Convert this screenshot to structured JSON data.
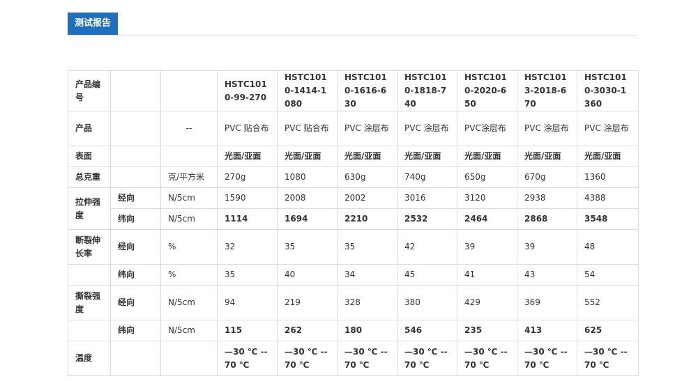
{
  "header": {
    "tab_label": "测试报告"
  },
  "colors": {
    "tab_background": "#1f6fbd",
    "tab_text": "#ffffff",
    "border": "#dcdcdc"
  },
  "table": {
    "product_code": {
      "label": "产品编号",
      "values": [
        "HSTC1010-99-270",
        "HSTC1010-1414-1080",
        "HSTC1010-1616-630",
        "HSTC1010-1818-740",
        "HSTC1010-2020-650",
        "HSTC1013-2018-670",
        "HSTC1010-3030-1360"
      ]
    },
    "product": {
      "label": "产品",
      "unit": "--",
      "values": [
        "PVC 贴合布",
        "PVC 贴合布",
        "PVC 涂层布",
        "PVC 涂层布",
        "PVC涂层布",
        "PVC 涂层布",
        "PVC 涂层布"
      ]
    },
    "surface": {
      "label": "表面",
      "values": [
        "光面/亚面",
        "光面/亚面",
        "光面/亚面",
        "光面/亚面",
        "光面/亚面",
        "光面/亚面",
        "光面/亚面"
      ]
    },
    "weight": {
      "label": "总克重",
      "unit": "克/平方米",
      "values": [
        "270g",
        "1080",
        "630g",
        "740g",
        "650g",
        "670g",
        "1360"
      ]
    },
    "tensile": {
      "label": "拉伸强度",
      "warp": {
        "label": "经向",
        "unit": "N/5cm",
        "values": [
          "1590",
          "2008",
          "2002",
          "3016",
          "3120",
          "2938",
          "4388"
        ]
      },
      "weft": {
        "label": "纬向",
        "unit": "N/5cm",
        "values": [
          "1114",
          "1694",
          "2210",
          "2532",
          "2464",
          "2868",
          "3548"
        ]
      }
    },
    "elongation": {
      "label": "断裂伸长率",
      "warp": {
        "label": "经向",
        "unit": "%",
        "values": [
          "32",
          "35",
          "35",
          "42",
          "39",
          "39",
          "48"
        ]
      },
      "weft": {
        "label": "纬向",
        "unit": "%",
        "values": [
          "35",
          "40",
          "34",
          "45",
          "41",
          "43",
          "54"
        ]
      }
    },
    "tear": {
      "label": "撕裂强度",
      "warp": {
        "label": "经向",
        "unit": "N/5cm",
        "values": [
          "94",
          "219",
          "328",
          "380",
          "429",
          "369",
          "552"
        ]
      },
      "weft": {
        "label": "纬向",
        "unit": "N/5cm",
        "values": [
          "115",
          "262",
          "180",
          "546",
          "235",
          "413",
          "625"
        ]
      }
    },
    "temperature": {
      "label": "温度",
      "values": [
        "—30 ℃ -- 70 ℃",
        "—30 ℃ -- 70 ℃",
        "—30 ℃ -- 70 ℃",
        "—30 ℃ -- 70 ℃",
        "—30 ℃ -- 70 ℃",
        "—30 ℃ -- 70 ℃",
        "—30 ℃ -- 70 ℃"
      ]
    }
  }
}
